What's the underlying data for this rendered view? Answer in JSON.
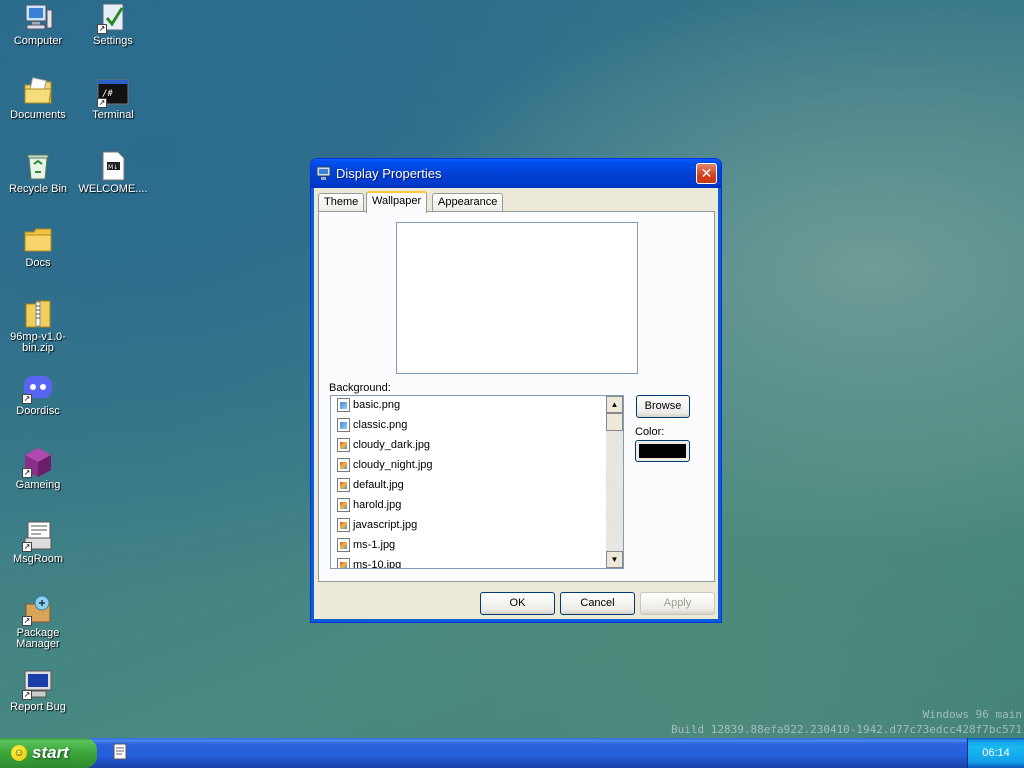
{
  "desktop": {
    "icons": [
      {
        "label": "Computer",
        "icon": "computer-icon"
      },
      {
        "label": "Settings",
        "icon": "settings-icon"
      },
      {
        "label": "Documents",
        "icon": "documents-icon"
      },
      {
        "label": "Terminal",
        "icon": "terminal-icon"
      },
      {
        "label": "Recycle Bin",
        "icon": "recycle-bin-icon"
      },
      {
        "label": "WELCOME....",
        "icon": "markdown-file-icon"
      },
      {
        "label": "Docs",
        "icon": "folder-icon"
      },
      {
        "label": "96mp-v1.0-bin.zip",
        "icon": "zip-file-icon"
      },
      {
        "label": "Doordisc",
        "icon": "discord-icon"
      },
      {
        "label": "Gameing",
        "icon": "game-cube-icon"
      },
      {
        "label": "MsgRoom",
        "icon": "msgroom-icon"
      },
      {
        "label": "Package Manager",
        "icon": "package-manager-icon"
      },
      {
        "label": "Report Bug",
        "icon": "report-bug-icon"
      }
    ],
    "watermark_line1": "Windows 96 main",
    "watermark_line2": "Build 12839.88efa922.230410-1942.d77c73edcc428f7bc571"
  },
  "window": {
    "title": "Display Properties",
    "close_label": "✕",
    "tabs": [
      {
        "label": "Theme",
        "active": false
      },
      {
        "label": "Wallpaper",
        "active": true
      },
      {
        "label": "Appearance",
        "active": false
      }
    ],
    "background_label": "Background:",
    "files": [
      {
        "name": "basic.png",
        "type": "png"
      },
      {
        "name": "classic.png",
        "type": "png"
      },
      {
        "name": "cloudy_dark.jpg",
        "type": "jpg"
      },
      {
        "name": "cloudy_night.jpg",
        "type": "jpg"
      },
      {
        "name": "default.jpg",
        "type": "jpg"
      },
      {
        "name": "harold.jpg",
        "type": "jpg"
      },
      {
        "name": "javascript.jpg",
        "type": "jpg"
      },
      {
        "name": "ms-1.jpg",
        "type": "jpg"
      },
      {
        "name": "ms-10.jpg",
        "type": "jpg"
      }
    ],
    "browse_label": "Browse",
    "color_label": "Color:",
    "color_value": "#000000",
    "ok_label": "OK",
    "cancel_label": "Cancel",
    "apply_label": "Apply"
  },
  "taskbar": {
    "start_label": "start",
    "clock": "06:14"
  },
  "colors": {
    "titlebar": "#0040d6",
    "start_button": "#3aa53a",
    "taskbar": "#245edb"
  }
}
